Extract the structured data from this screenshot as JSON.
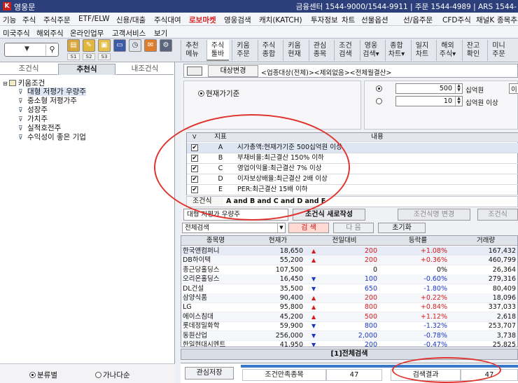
{
  "titlebar": {
    "title": "영웅문",
    "info": "금융센터 1544-9000/1544-9911 | 주문 1544-4989 | ARS 1544-"
  },
  "menu1": [
    "기능",
    "주식",
    "주식주문",
    "ETF/ELW",
    "신용/대출",
    "주식대여",
    "로보마켓",
    "영웅검색",
    "캐치(KATCH)",
    "투자정보",
    "차트",
    "선물옵션",
    "선/옵주문",
    "CFD주식",
    "채널K",
    "종목추천"
  ],
  "menu2": [
    "미국주식",
    "해외주식",
    "온라인업무",
    "고객서비스",
    "보기"
  ],
  "toolbar": {
    "labels": [
      "S1",
      "S2",
      "S3"
    ],
    "quick": [
      [
        "추천",
        "메뉴"
      ],
      [
        "주식",
        "툴바"
      ],
      [
        "키움",
        "주문"
      ],
      [
        "주식",
        "종합"
      ],
      [
        "키움",
        "현재"
      ],
      [
        "관심",
        "종목"
      ],
      [
        "조건",
        "검색"
      ],
      [
        "영웅",
        "검색▾"
      ],
      [
        "종합",
        "차트▾"
      ],
      [
        "일지",
        "차트"
      ],
      [
        "해외",
        "주식▾"
      ],
      [
        "잔고",
        "확인"
      ],
      [
        "미니",
        "주문"
      ]
    ]
  },
  "left": {
    "tabs": [
      "조건식",
      "추천식",
      "내조건식"
    ],
    "tree_root": "키움조건",
    "tree_items": [
      "대형 저평가 우량주",
      "중소형 저평가주",
      "성장주",
      "가치주",
      "실적호전주",
      "수익성이 좋은 기업"
    ],
    "radio1": "분류별",
    "radio2": "가나다순"
  },
  "cond": {
    "change_btn": "대상변경",
    "target_text": "<업종대상(전체)><제외없음><전체월결산>",
    "radio_label": "현재가기준",
    "spin1": "500",
    "spin1_unit": "십억원",
    "spin1_tail": "이",
    "spin2": "10",
    "spin2_unit": "십억원 이상",
    "col_index": "지표",
    "col_content": "내용",
    "rows": [
      {
        "id": "A",
        "text": "시가총액:현재가기준 500십억원 이상"
      },
      {
        "id": "B",
        "text": "부채비율:최근결산 150% 이하"
      },
      {
        "id": "C",
        "text": "영업이익율:최근결산 7% 이상"
      },
      {
        "id": "D",
        "text": "이자보상배율:최근결산 2배 이상"
      },
      {
        "id": "E",
        "text": "PER:최근결산 15배 이하"
      }
    ],
    "expr_label": "조건식",
    "expr": "A and B and C and D and E",
    "name_value": "대형 저평가 우량주",
    "new_btn": "조건식 새로작성",
    "rename_btn": "조건식명 변경",
    "cond_btn": "조건식"
  },
  "search": {
    "combo": "전체검색",
    "search_btn": "검 색",
    "next_btn": "다 음",
    "reset_btn": "초기화"
  },
  "grid": {
    "headers": [
      "종목명",
      "현재가",
      "전일대비",
      "등락률",
      "거래량"
    ],
    "rows": [
      {
        "name": "한국앤컴퍼니",
        "price": "18,650",
        "dir": "up",
        "change": "200",
        "rate": "+1.08%",
        "vol": "167,432"
      },
      {
        "name": "DB하이텍",
        "price": "55,200",
        "dir": "up",
        "change": "200",
        "rate": "+0.36%",
        "vol": "460,799"
      },
      {
        "name": "종근당홀딩스",
        "price": "107,500",
        "dir": "flat",
        "change": "0",
        "rate": "0%",
        "vol": "26,364"
      },
      {
        "name": "오리온홀딩스",
        "price": "16,450",
        "dir": "dn",
        "change": "100",
        "rate": "-0.60%",
        "vol": "279,316"
      },
      {
        "name": "DL건설",
        "price": "35,500",
        "dir": "dn",
        "change": "650",
        "rate": "-1.80%",
        "vol": "80,409"
      },
      {
        "name": "삼양식품",
        "price": "90,400",
        "dir": "up",
        "change": "200",
        "rate": "+0.22%",
        "vol": "18,096"
      },
      {
        "name": "LG",
        "price": "95,800",
        "dir": "up",
        "change": "800",
        "rate": "+0.84%",
        "vol": "337,033"
      },
      {
        "name": "에이스침대",
        "price": "45,200",
        "dir": "up",
        "change": "500",
        "rate": "+1.12%",
        "vol": "2,618"
      },
      {
        "name": "롯데정밀화학",
        "price": "59,900",
        "dir": "dn",
        "change": "800",
        "rate": "-1.32%",
        "vol": "253,707"
      },
      {
        "name": "동원산업",
        "price": "256,000",
        "dir": "dn",
        "change": "2,000",
        "rate": "-0.78%",
        "vol": "3,738"
      },
      {
        "name": "한일현대시멘트",
        "price": "41,950",
        "dir": "dn",
        "change": "200",
        "rate": "-0.47%",
        "vol": "25,825"
      }
    ]
  },
  "result": {
    "title": "[1]전체검색",
    "save_btn": "관심저장",
    "cond_label": "조건만족종목",
    "cond_count": "47",
    "result_label": "검색결과",
    "result_count": "47"
  },
  "colors": {
    "up": "#d41a1a",
    "down": "#1a37c5",
    "title_bg": "#2d3f7a",
    "annotation": "#e0342e"
  }
}
